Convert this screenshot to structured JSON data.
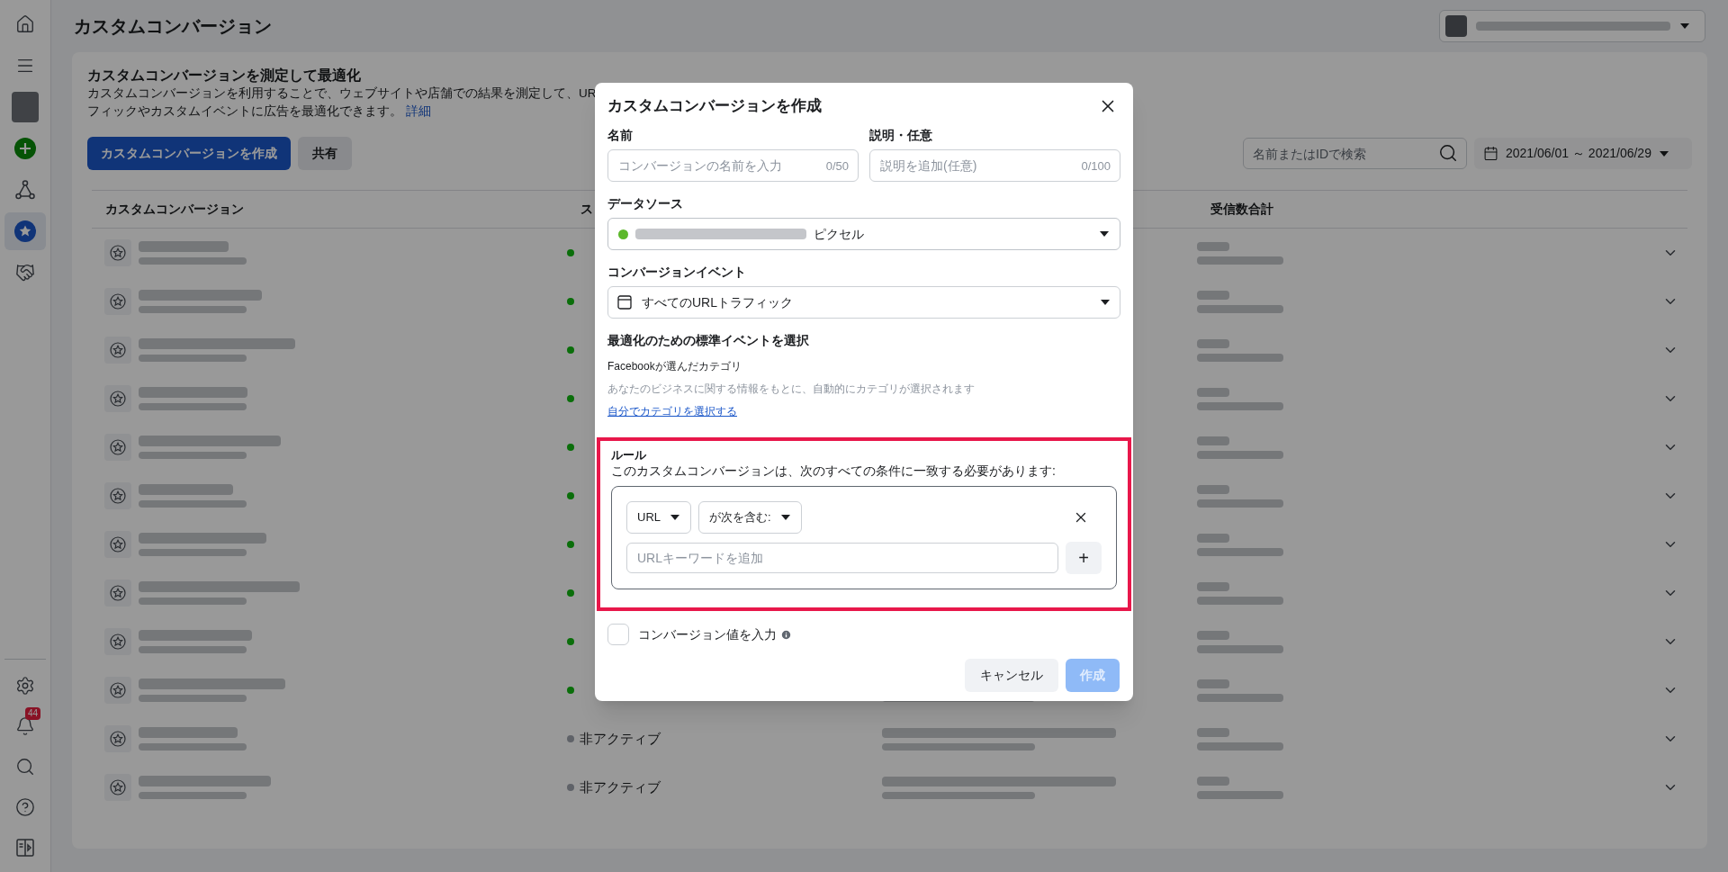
{
  "sidebar": {
    "items": [
      {
        "kind": "home",
        "selected": false
      },
      {
        "kind": "menu",
        "selected": false
      },
      {
        "kind": "avatar",
        "selected": false
      },
      {
        "kind": "create",
        "selected": false
      },
      {
        "kind": "events",
        "selected": false
      },
      {
        "kind": "custom_conversions",
        "selected": true
      },
      {
        "kind": "partners",
        "selected": false
      }
    ],
    "bottom_items": [
      {
        "kind": "settings"
      },
      {
        "kind": "notifications",
        "badge": "44"
      },
      {
        "kind": "search"
      },
      {
        "kind": "help"
      },
      {
        "kind": "panel"
      }
    ]
  },
  "page": {
    "title": "カスタムコンバージョン",
    "intro": {
      "heading": "カスタムコンバージョンを測定して最適化",
      "line_1": "カスタムコンバージョンを利用することで、ウェブサイトや店舗での結果を測定して、UR",
      "line_2": "フィックやカスタムイベントに広告を最適化できます。",
      "link": "詳細"
    },
    "buttons": [
      {
        "label": "カスタムコンバージョンを作成",
        "kind": "primary"
      },
      {
        "label": "共有",
        "kind": "secondary"
      }
    ],
    "search": {
      "placeholder": "名前またはIDで検索"
    },
    "date_range": "2021/06/01 ～ 2021/06/29",
    "table": {
      "columns": [
        "カスタムコンバージョン",
        "ス",
        "受信数合計"
      ],
      "rows": [
        {
          "color": "#0a6e0a"
        },
        {
          "color": "#0a6e0a"
        },
        {
          "color": "#0a6e0a"
        },
        {
          "color": "#0a6e0a"
        },
        {
          "color": "#0a6e0a"
        },
        {
          "color": "#0a6e0a"
        },
        {
          "color": "#0a6e0a"
        },
        {
          "color": "#0a6e0a"
        },
        {
          "color": "#0a6e0a"
        },
        {
          "color": "#0a6e0a"
        },
        {
          "color": "#5f6268",
          "status": "非アクティブ"
        },
        {
          "color": "#5f6268",
          "status": "非アクティブ"
        }
      ]
    }
  },
  "dialog": {
    "title": "カスタムコンバージョンを作成",
    "fields": [
      {
        "label": "名前",
        "placeholder": "コンバージョンの名前を入力",
        "counter": "0/50"
      },
      {
        "label": "説明・任意",
        "placeholder": "説明を追加(任意)",
        "counter": "0/100"
      }
    ],
    "data_source": {
      "label": "データソース",
      "value": "ピクセル",
      "color": "#5cb82b"
    },
    "conversion_event": {
      "label": "コンバージョンイベント",
      "value": "すべてのURLトラフィック"
    },
    "standard_event": {
      "heading": "最適化のための標準イベントを選択",
      "subheading": "Facebookが選んだカテゴリ",
      "description": "あなたのビジネスに関する情報をもとに、自動的にカテゴリが選択されます",
      "link": "自分でカテゴリを選択する"
    },
    "rules": {
      "highlighted": true,
      "heading": "ルール",
      "description": "このカスタムコンバージョンは、次のすべての条件に一致する必要があります:",
      "conditions": [
        {
          "field": "URL",
          "operator": "が次を含む:",
          "placeholder": "URLキーワードを追加",
          "add": "+"
        }
      ]
    },
    "conversion_value": {
      "label": "コンバージョン値を入力",
      "checked": false
    },
    "buttons": [
      {
        "label": "キャンセル",
        "kind": "secondary",
        "disabled": false
      },
      {
        "label": "作成",
        "kind": "primary",
        "disabled": true
      }
    ]
  }
}
